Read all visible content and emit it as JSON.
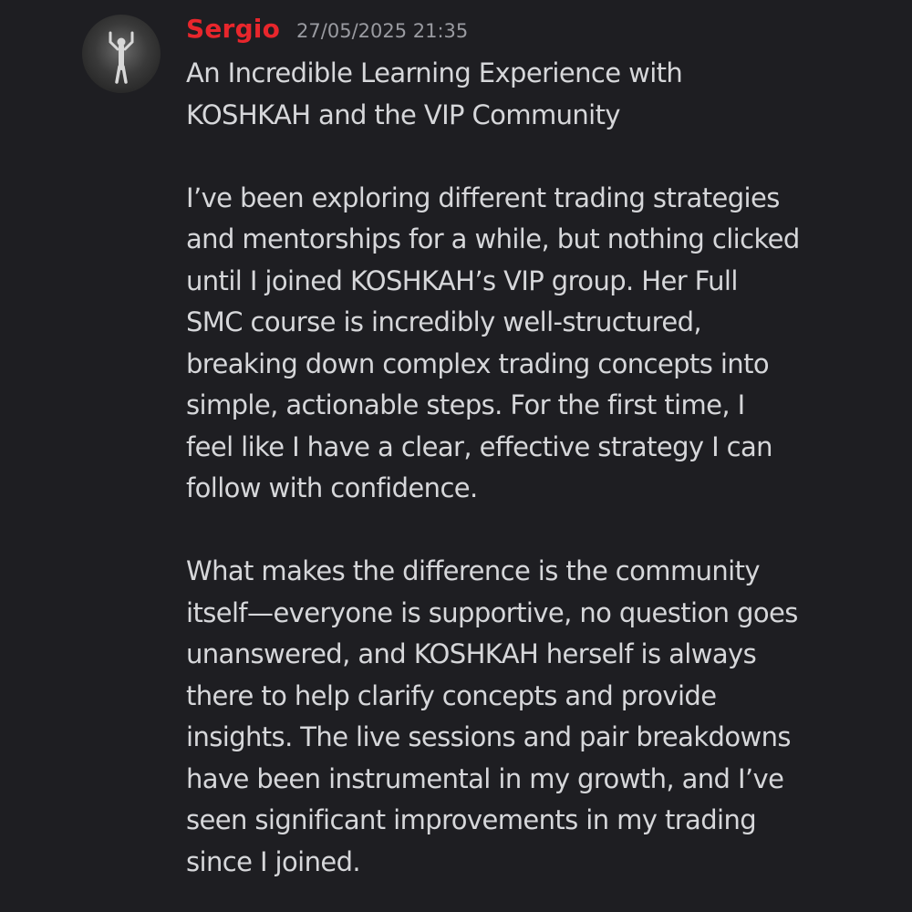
{
  "message": {
    "author": "Sergio",
    "timestamp": "27/05/2025 21:35",
    "author_color": "#e8262c",
    "avatar_icon": "person-arms-raised-avatar",
    "paragraphs": [
      [
        "An Incredible Learning Experience with",
        "KOSHKAH and the VIP Community"
      ],
      [
        "I’ve been exploring different trading strategies",
        "and mentorships for a while, but nothing clicked",
        "until I joined KOSHKAH’s VIP group. Her Full",
        "SMC course is incredibly well-structured,",
        "breaking down complex trading concepts into",
        "simple, actionable steps. For the first time, I",
        "feel like I have a clear, effective strategy I can",
        "follow with confidence."
      ],
      [
        "What makes the difference is the community",
        "itself—everyone is supportive, no question goes",
        "unanswered, and KOSHKAH herself is always",
        "there to help clarify concepts and provide",
        "insights. The live sessions and pair breakdowns",
        "have been instrumental in my growth, and I’ve",
        "seen significant improvements in my trading",
        "since I joined."
      ]
    ]
  }
}
